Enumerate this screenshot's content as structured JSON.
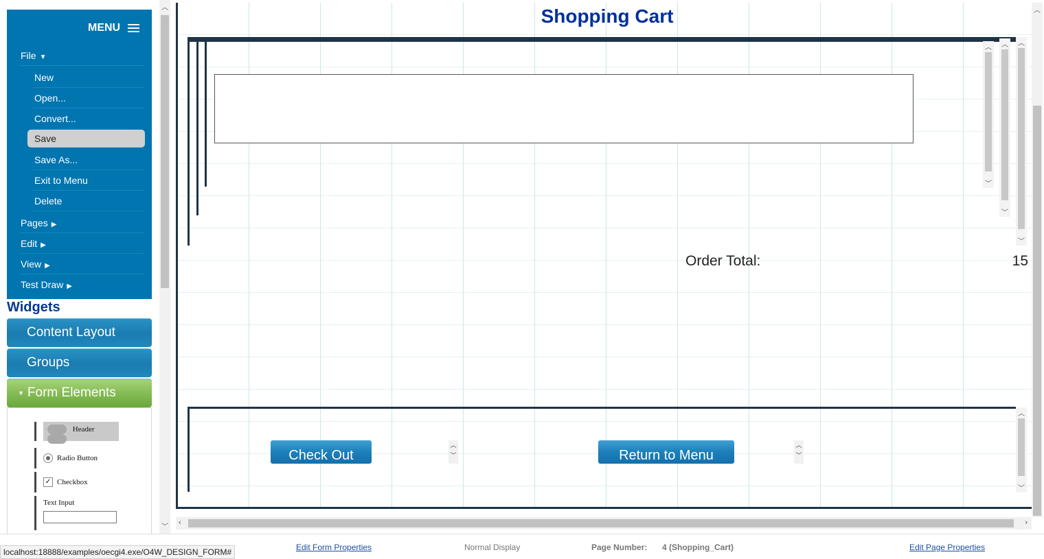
{
  "menu": {
    "title": "MENU",
    "file": "File",
    "file_items": [
      "New",
      "Open...",
      "Convert...",
      "Save",
      "Save As...",
      "Exit to Menu",
      "Delete"
    ],
    "pages": "Pages",
    "edit": "Edit",
    "view": "View",
    "test_draw": "Test Draw"
  },
  "widgets": {
    "title": "Widgets",
    "sections": [
      "Content Layout",
      "Groups",
      "Form Elements"
    ],
    "form_elements": {
      "header": "Header",
      "radio": "Radio Button",
      "checkbox": "Checkbox",
      "text_input": "Text Input"
    }
  },
  "canvas": {
    "title": "Shopping Cart",
    "order_total_label": "Order Total:",
    "order_total_value": "15",
    "checkout_button": "Check Out",
    "return_button": "Return to Menu"
  },
  "status": {
    "url": "localhost:18888/examples/oecgi4.exe/O4W_DESIGN_FORM#",
    "edit_form_properties": "Edit Form Properties",
    "display_mode": "Normal Display",
    "page_number_label": "Page Number:",
    "page_number_value": "4 (Shopping_Cart)",
    "edit_page_properties": "Edit Page Properties"
  },
  "colors": {
    "menu_bg": "#0075b0",
    "title_blue": "#00309a",
    "accordion_blue": "#1a7cb0",
    "accordion_green": "#7fb84f",
    "frame_navy": "#1e3346"
  },
  "icons": [
    "hamburger-icon",
    "chevron-down-icon",
    "chevron-up-icon",
    "checkmark-icon"
  ]
}
